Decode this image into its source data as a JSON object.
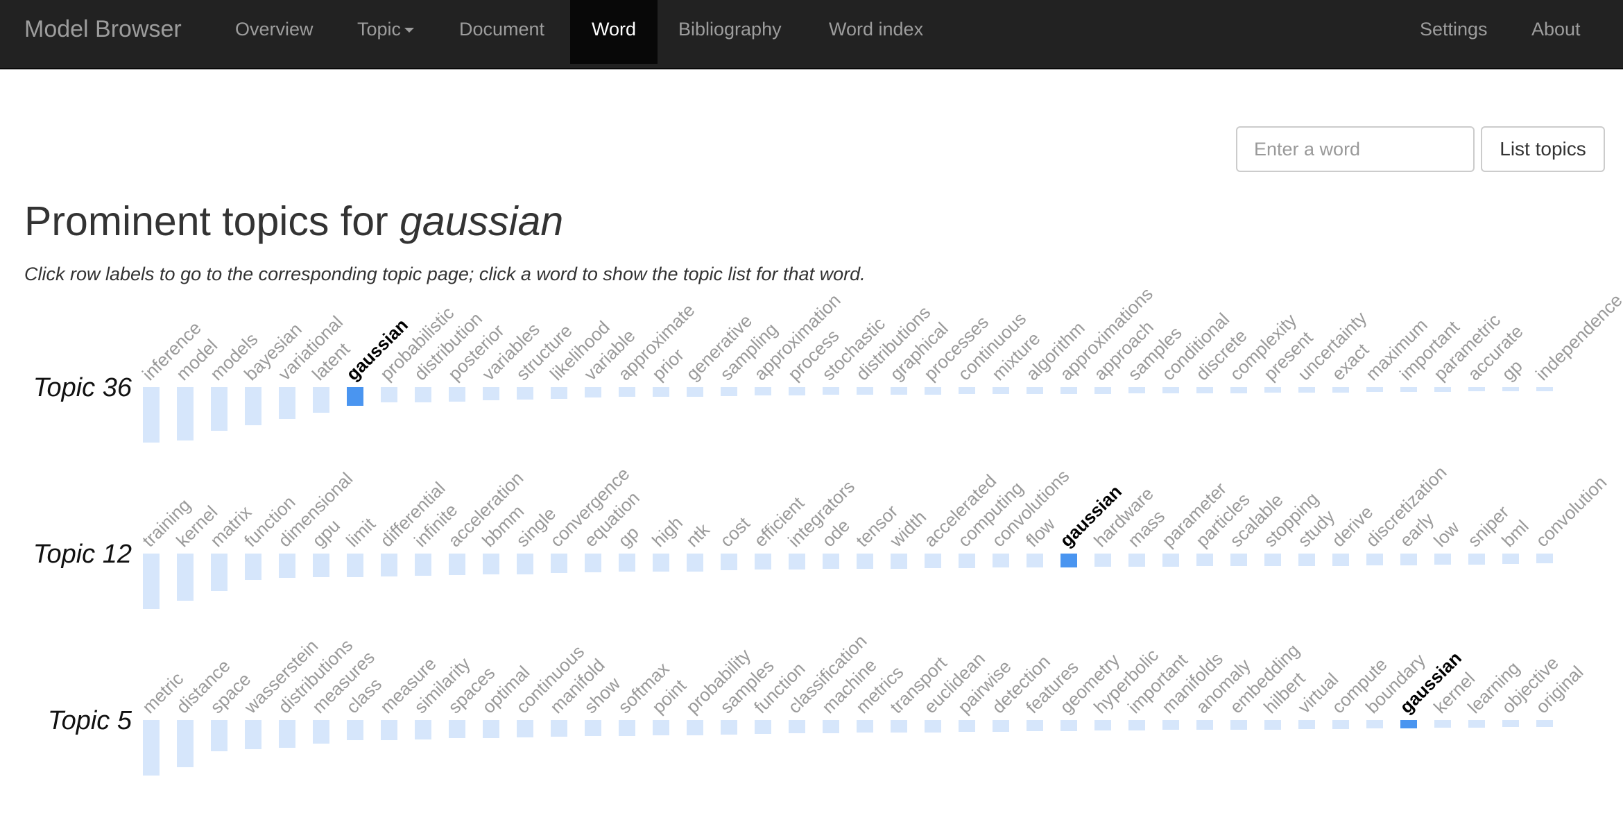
{
  "navbar": {
    "brand": "Model Browser",
    "items": [
      {
        "label": "Overview"
      },
      {
        "label": "Topic"
      },
      {
        "label": "Document"
      },
      {
        "label": "Word"
      },
      {
        "label": "Bibliography"
      },
      {
        "label": "Word index"
      }
    ],
    "right_items": [
      {
        "label": "Settings"
      },
      {
        "label": "About"
      }
    ],
    "active": "Word"
  },
  "search": {
    "placeholder": "Enter a word",
    "value": "",
    "button_label": "List topics"
  },
  "page": {
    "title_prefix": "Prominent topics for ",
    "title_word": "gaussian",
    "subtitle": "Click row labels to go to the corresponding topic page; click a word to show the topic list for that word."
  },
  "colors": {
    "bar": "#d6e6fb",
    "highlight_bar": "#4a95f0",
    "navbar_bg": "#222222",
    "active_tab_bg": "#080808"
  },
  "topics": [
    {
      "label": "Topic 36",
      "words": [
        "inference",
        "model",
        "models",
        "bayesian",
        "variational",
        "latent",
        "gaussian",
        "probabilistic",
        "distribution",
        "posterior",
        "variables",
        "structure",
        "likelihood",
        "variable",
        "approximate",
        "prior",
        "generative",
        "sampling",
        "approximation",
        "process",
        "stochastic",
        "distributions",
        "graphical",
        "processes",
        "continuous",
        "mixture",
        "algorithm",
        "approximations",
        "approach",
        "samples",
        "conditional",
        "discrete",
        "complexity",
        "present",
        "uncertainty",
        "exact",
        "maximum",
        "important",
        "parametric",
        "accurate",
        "gp",
        "independence"
      ],
      "weights": [
        1.0,
        0.96,
        0.79,
        0.69,
        0.57,
        0.46,
        0.34,
        0.28,
        0.27,
        0.26,
        0.24,
        0.23,
        0.21,
        0.19,
        0.18,
        0.18,
        0.17,
        0.16,
        0.15,
        0.15,
        0.14,
        0.14,
        0.14,
        0.14,
        0.13,
        0.13,
        0.12,
        0.12,
        0.12,
        0.11,
        0.11,
        0.11,
        0.11,
        0.1,
        0.1,
        0.1,
        0.09,
        0.09,
        0.09,
        0.08,
        0.08,
        0.07
      ]
    },
    {
      "label": "Topic 12",
      "words": [
        "training",
        "kernel",
        "matrix",
        "function",
        "dimensional",
        "gpu",
        "limit",
        "differential",
        "infinite",
        "acceleration",
        "bbmm",
        "single",
        "convergence",
        "equation",
        "gp",
        "high",
        "ntk",
        "cost",
        "efficient",
        "integrators",
        "ode",
        "tensor",
        "width",
        "accelerated",
        "computing",
        "convolutions",
        "flow",
        "gaussian",
        "hardware",
        "mass",
        "parameter",
        "particles",
        "scalable",
        "stopping",
        "study",
        "derive",
        "discretization",
        "early",
        "low",
        "sniper",
        "bml",
        "convolution"
      ],
      "weights": [
        1.0,
        0.85,
        0.68,
        0.47,
        0.44,
        0.43,
        0.42,
        0.41,
        0.4,
        0.39,
        0.38,
        0.37,
        0.35,
        0.34,
        0.33,
        0.32,
        0.32,
        0.3,
        0.29,
        0.29,
        0.28,
        0.28,
        0.27,
        0.26,
        0.26,
        0.25,
        0.25,
        0.25,
        0.24,
        0.24,
        0.24,
        0.23,
        0.23,
        0.23,
        0.22,
        0.22,
        0.21,
        0.21,
        0.2,
        0.2,
        0.19,
        0.18
      ]
    },
    {
      "label": "Topic 5",
      "words": [
        "metric",
        "distance",
        "space",
        "wasserstein",
        "distributions",
        "measures",
        "class",
        "measure",
        "similarity",
        "spaces",
        "optimal",
        "continuous",
        "manifold",
        "show",
        "softmax",
        "point",
        "probability",
        "samples",
        "function",
        "classification",
        "machine",
        "metrics",
        "transport",
        "euclidean",
        "pairwise",
        "detection",
        "features",
        "geometry",
        "hyperbolic",
        "important",
        "manifolds",
        "anomaly",
        "embedding",
        "hilbert",
        "virtual",
        "compute",
        "boundary",
        "gaussian",
        "kernel",
        "learning",
        "objective",
        "original"
      ],
      "weights": [
        1.0,
        0.85,
        0.56,
        0.53,
        0.5,
        0.42,
        0.36,
        0.36,
        0.35,
        0.33,
        0.32,
        0.31,
        0.3,
        0.29,
        0.29,
        0.28,
        0.27,
        0.26,
        0.25,
        0.24,
        0.24,
        0.23,
        0.23,
        0.22,
        0.21,
        0.21,
        0.2,
        0.2,
        0.19,
        0.19,
        0.18,
        0.18,
        0.17,
        0.17,
        0.16,
        0.16,
        0.15,
        0.15,
        0.14,
        0.14,
        0.13,
        0.13
      ]
    }
  ]
}
